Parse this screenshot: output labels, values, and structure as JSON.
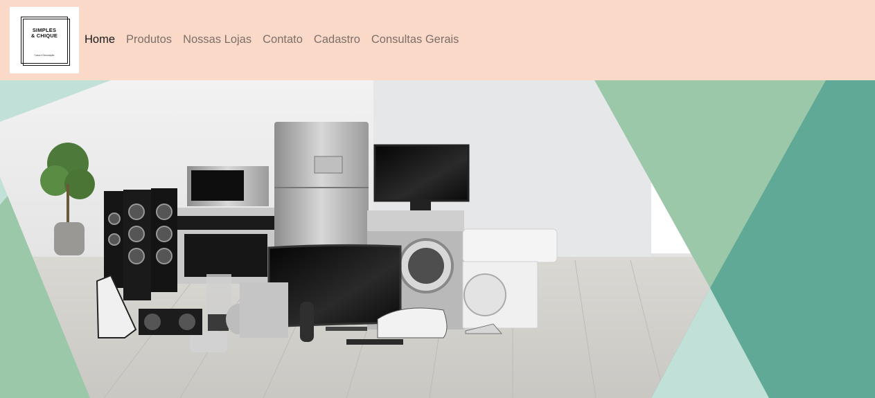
{
  "brand": {
    "line1": "SIMPLES",
    "line2": "& CHIQUE",
    "tagline": "Casa e Decoração"
  },
  "nav": {
    "items": [
      {
        "label": "Home",
        "active": true
      },
      {
        "label": "Produtos",
        "active": false
      },
      {
        "label": "Nossas Lojas",
        "active": false
      },
      {
        "label": "Contato",
        "active": false
      },
      {
        "label": "Cadastro",
        "active": false
      },
      {
        "label": "Consultas Gerais",
        "active": false
      }
    ]
  },
  "colors": {
    "navbar_bg": "#fad9c9",
    "nav_active": "#1a1a1a",
    "nav_inactive": "#7d6f68",
    "teal_dark": "#5fa996",
    "teal_mid": "#9bc8a9",
    "teal_light": "#c0e0d8"
  },
  "hero": {
    "image": "home-appliances-banner"
  }
}
